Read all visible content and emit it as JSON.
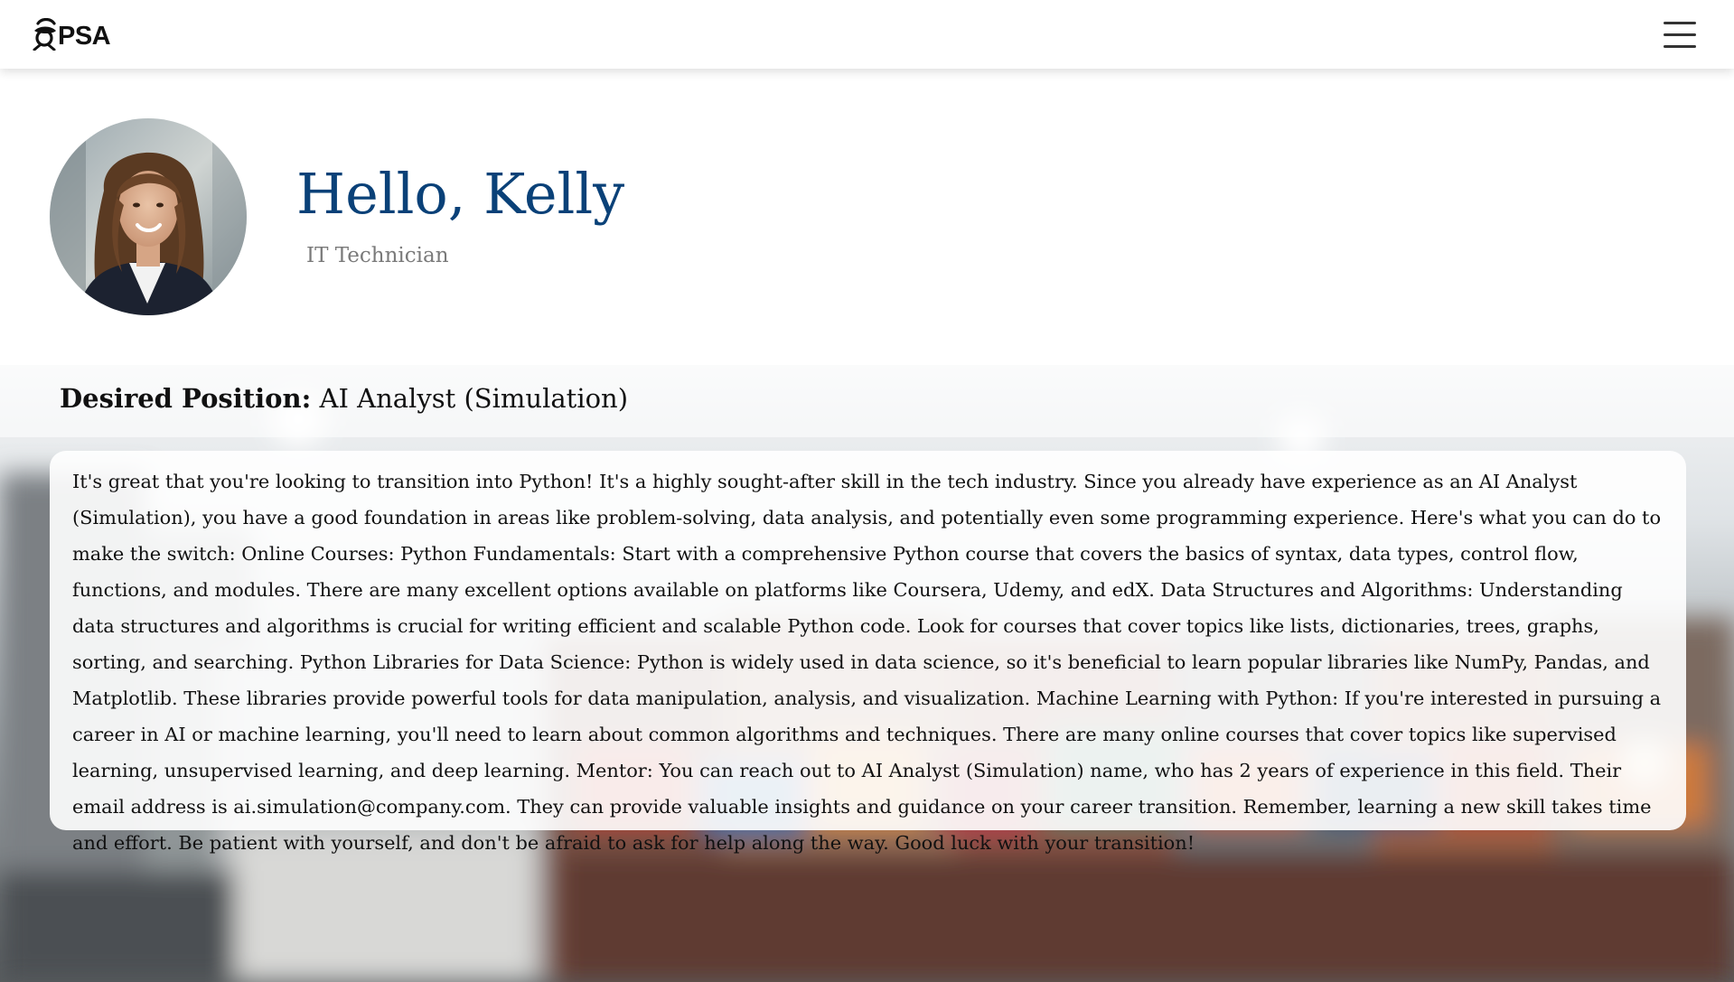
{
  "brand": {
    "logo_text": "PSA",
    "logo_icon": "psa-logo-icon"
  },
  "navbar": {
    "menu_icon": "hamburger-menu-icon"
  },
  "profile": {
    "greeting": "Hello, Kelly",
    "job_title": "IT Technician",
    "avatar_icon": "profile-photo"
  },
  "desired_position": {
    "label": "Desired Position:",
    "value": " AI Analyst (Simulation)"
  },
  "advice": {
    "text": "It's great that you're looking to transition into Python! It's a highly sought-after skill in the tech industry. Since you already have experience as an AI Analyst (Simulation), you have a good foundation in areas like problem-solving, data analysis, and potentially even some programming experience. Here's what you can do to make the switch: Online Courses: Python Fundamentals: Start with a comprehensive Python course that covers the basics of syntax, data types, control flow, functions, and modules. There are many excellent options available on platforms like Coursera, Udemy, and edX. Data Structures and Algorithms: Understanding data structures and algorithms is crucial for writing efficient and scalable Python code. Look for courses that cover topics like lists, dictionaries, trees, graphs, sorting, and searching. Python Libraries for Data Science: Python is widely used in data science, so it's beneficial to learn popular libraries like NumPy, Pandas, and Matplotlib. These libraries provide powerful tools for data manipulation, analysis, and visualization. Machine Learning with Python: If you're interested in pursuing a career in AI or machine learning, you'll need to learn about common algorithms and techniques. There are many online courses that cover topics like supervised learning, unsupervised learning, and deep learning. Mentor: You can reach out to AI Analyst (Simulation) name, who has 2 years of experience in this field. Their email address is ai.simulation@company.com. They can provide valuable insights and guidance on your career transition. Remember, learning a new skill takes time and effort. Be patient with yourself, and don't be afraid to ask for help along the way. Good luck with your transition!"
  },
  "colors": {
    "greeting": "#0a4178",
    "job_title": "#7a7a7a",
    "navbar_bg": "#ffffff",
    "card_bg": "rgba(255,255,255,0.9)"
  }
}
